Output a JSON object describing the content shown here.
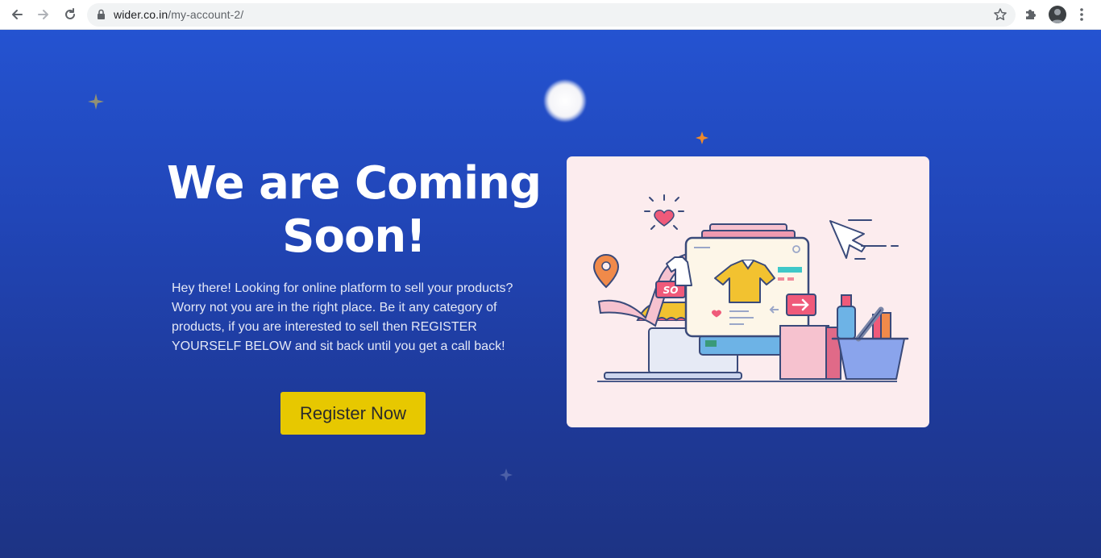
{
  "browser": {
    "url_host": "wider.co.in",
    "url_path": "/my-account-2/"
  },
  "hero": {
    "headline": "We are Coming Soon!",
    "description": "Hey there! Looking for online platform to sell your products? Worry not you are in the right place. Be it any category of products, if you are interested to sell then REGISTER YOURSELF BELOW and sit back until you get a call back!",
    "register_label": "Register Now"
  },
  "illustration": {
    "sale_sign": "SO"
  },
  "colors": {
    "background_top": "#2453d1",
    "background_bottom": "#1d3384",
    "button": "#e7c800",
    "card": "#fcecee"
  }
}
